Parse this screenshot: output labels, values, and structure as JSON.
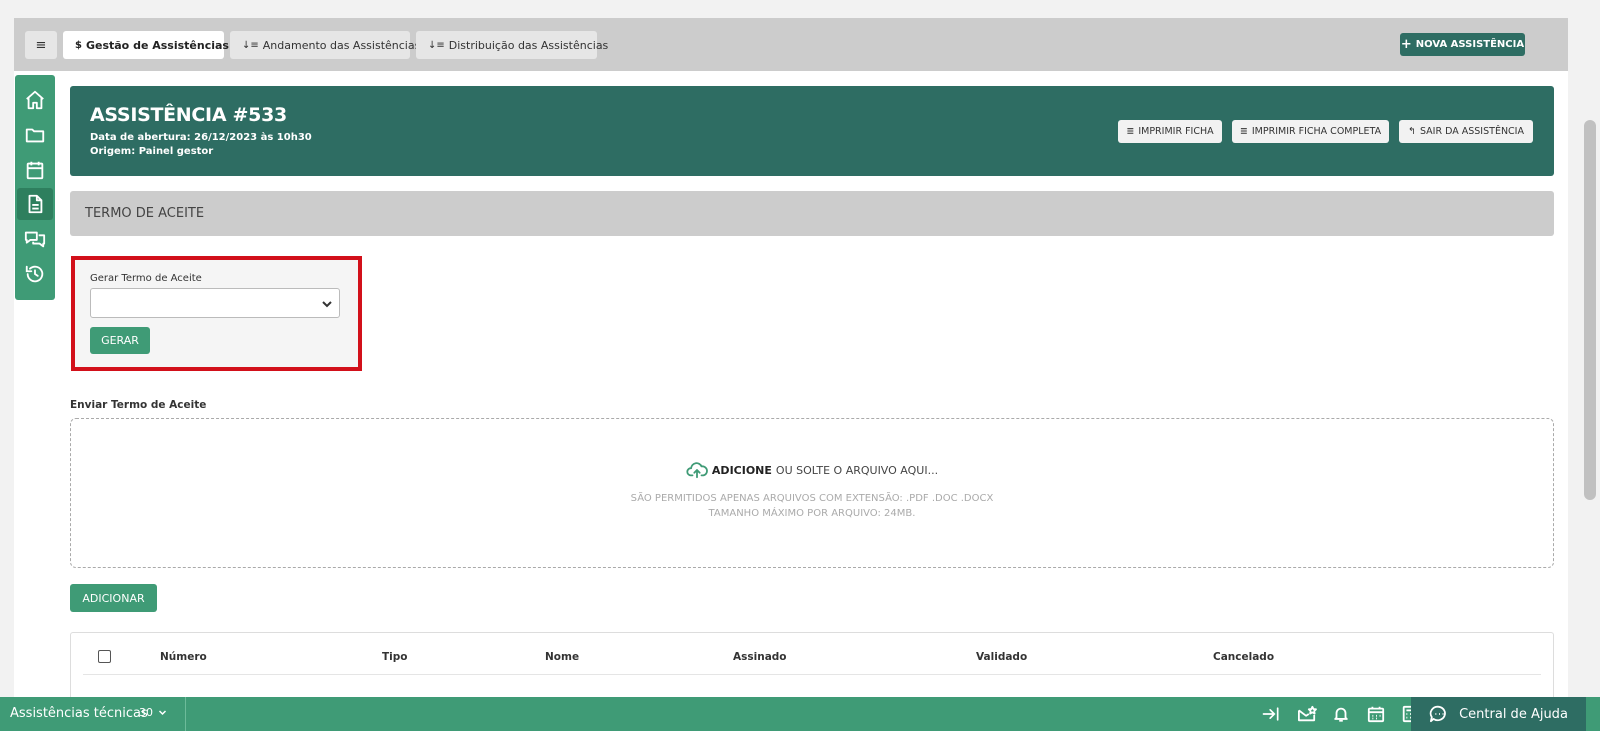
{
  "tabs": {
    "menu_label": "≡",
    "gestao_label": "Gestão de Assistências",
    "andamento_label": "Andamento das Assistências",
    "distribuicao_label": "Distribuição das Assistências"
  },
  "toolbar": {
    "nova_label": "NOVA ASSISTÊNCIA"
  },
  "sidenav": {
    "items": [
      "home-icon",
      "folder-icon",
      "calendar-icon",
      "document-icon",
      "chat-icon",
      "history-icon"
    ]
  },
  "header": {
    "title": "ASSISTÊNCIA #533",
    "opening": "Data de abertura: 26/12/2023 às 10h30",
    "origin": "Origem: Painel gestor",
    "print_label": "IMPRIMIR FICHA",
    "print_full_label": "IMPRIMIR FICHA COMPLETA",
    "exit_label": "SAIR DA ASSISTÊNCIA"
  },
  "section": {
    "title": "TERMO DE ACEITE"
  },
  "generate": {
    "label": "Gerar Termo de Aceite",
    "selected_value": "",
    "button_label": "GERAR"
  },
  "upload": {
    "label": "Enviar Termo de Aceite",
    "add_strong": "ADICIONE",
    "add_rest": "OU SOLTE O ARQUIVO AQUI...",
    "allowed": "SÃO PERMITIDOS APENAS ARQUIVOS COM EXTENSÃO: .PDF .DOC .DOCX",
    "max_size": "TAMANHO MÁXIMO POR ARQUIVO: 24MB.",
    "button_label": "ADICIONAR"
  },
  "table": {
    "columns": [
      "Número",
      "Tipo",
      "Nome",
      "Assinado",
      "Validado",
      "Cancelado"
    ]
  },
  "bottombar": {
    "title": "Assistências técnicas",
    "count": "30",
    "help_label": "Central de Ajuda"
  },
  "colors": {
    "primary_dark": "#2e6d63",
    "primary": "#3f9b76",
    "highlight": "#d2101a"
  }
}
